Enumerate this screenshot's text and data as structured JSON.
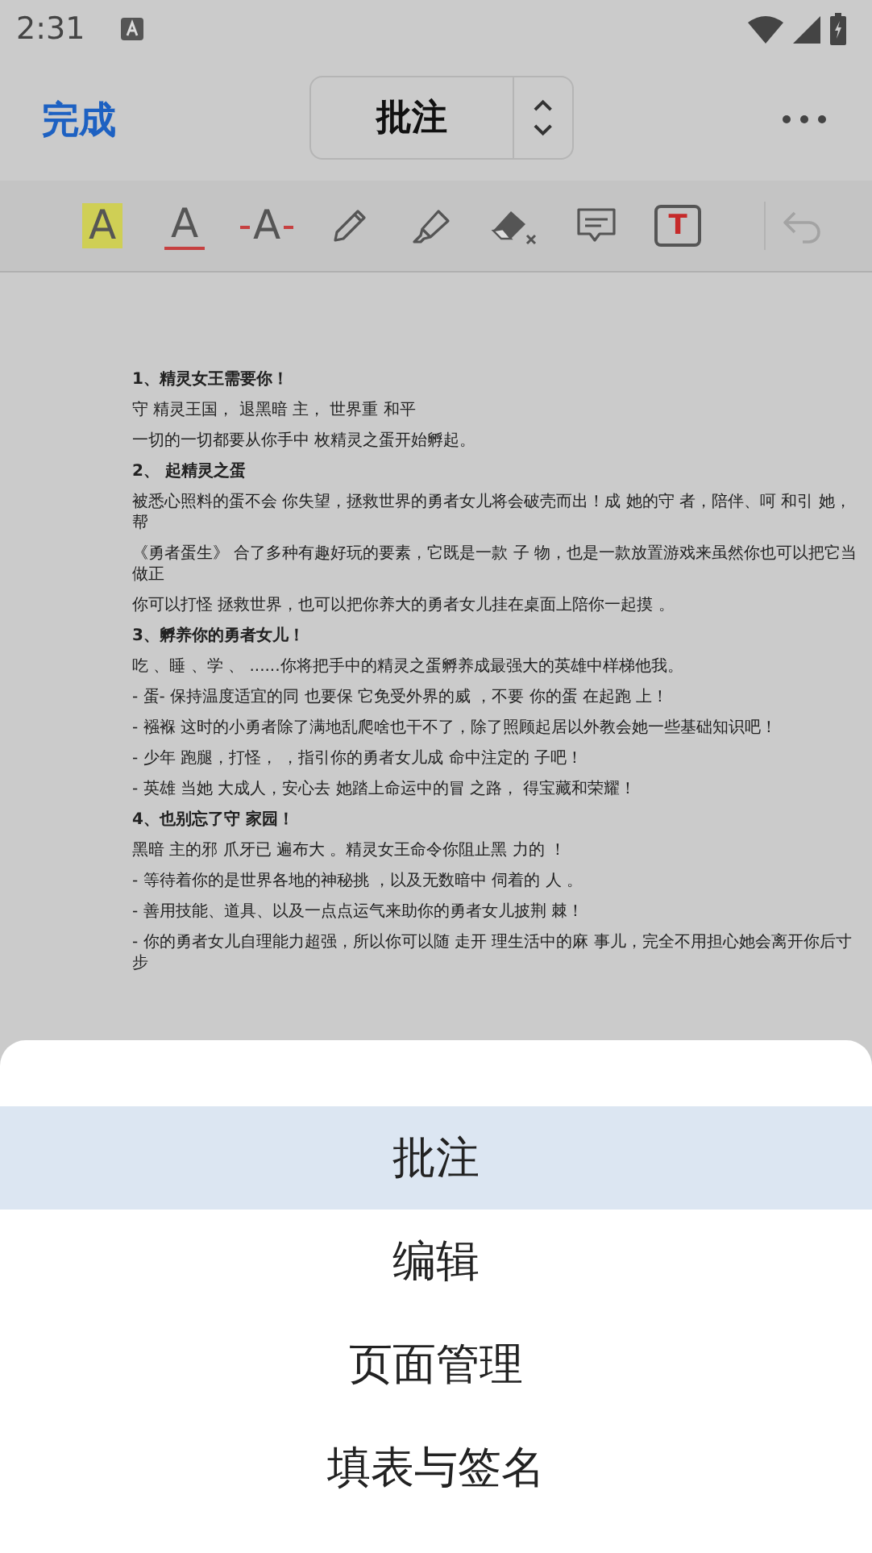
{
  "status_bar": {
    "time": "2:31"
  },
  "header": {
    "done": "完成",
    "mode": "批注"
  },
  "toolbar": {
    "tools": [
      {
        "kind": "highlight",
        "label": "A"
      },
      {
        "kind": "underline",
        "label": "A"
      },
      {
        "kind": "strikeout",
        "label": "A"
      },
      {
        "kind": "pencil"
      },
      {
        "kind": "marker"
      },
      {
        "kind": "eraser"
      },
      {
        "kind": "comment"
      },
      {
        "kind": "textbox",
        "label": "T"
      }
    ],
    "undo": {
      "disabled": true
    }
  },
  "document": {
    "lines": [
      {
        "kind": "heading",
        "text": "1、精灵女王需要你！"
      },
      {
        "kind": "para",
        "text": "守 精灵王国， 退黑暗 主， 世界重 和平"
      },
      {
        "kind": "para",
        "text": "一切的一切都要从你手中 枚精灵之蛋开始孵起。"
      },
      {
        "kind": "heading",
        "text": "2、 起精灵之蛋"
      },
      {
        "kind": "para",
        "text": "被悉心照料的蛋不会 你失望，拯救世界的勇者女儿将会破壳而出！成 她的守 者，陪伴、呵 和引 她，帮"
      },
      {
        "kind": "para",
        "text": "《勇者蛋生》 合了多种有趣好玩的要素，它既是一款 子 物，也是一款放置游戏来虽然你也可以把它当做正"
      },
      {
        "kind": "para",
        "text": "你可以打怪 拯救世界，也可以把你养大的勇者女儿挂在桌面上陪你一起摸 。"
      },
      {
        "kind": "heading",
        "text": "3、孵养你的勇者女儿！"
      },
      {
        "kind": "para",
        "text": "吃 、睡 、学 、 ......你将把手中的精灵之蛋孵养成最强大的英雄中样梯他我。"
      },
      {
        "kind": "para",
        "text": "- 蛋- 保持温度适宜的同 也要保 它免受外界的威 ，不要 你的蛋 在起跑 上！"
      },
      {
        "kind": "para",
        "text": "- 襁褓 这时的小勇者除了满地乱爬啥也干不了，除了照顾起居以外教会她一些基础知识吧！"
      },
      {
        "kind": "para",
        "text": "- 少年 跑腿，打怪， ，指引你的勇者女儿成 命中注定的 子吧！"
      },
      {
        "kind": "para",
        "text": "- 英雄 当她 大成人，安心去 她踏上命运中的冒 之路， 得宝藏和荣耀！"
      },
      {
        "kind": "heading",
        "text": "4、也别忘了守 家园！"
      },
      {
        "kind": "para",
        "text": "黑暗 主的邪 爪牙已 遍布大 。精灵女王命令你阻止黑 力的 ！"
      },
      {
        "kind": "para",
        "text": "- 等待着你的是世界各地的神秘挑 ，以及无数暗中 伺着的 人 。"
      },
      {
        "kind": "para",
        "text": "- 善用技能、道具、以及一点点运气来助你的勇者女儿披荆 棘！"
      },
      {
        "kind": "para",
        "text": "- 你的勇者女儿自理能力超强，所以你可以随 走开 理生活中的麻 事儿，完全不用担心她会离开你后寸步"
      }
    ]
  },
  "sheet": {
    "items": [
      {
        "label": "批注",
        "selected": true
      },
      {
        "label": "编辑",
        "selected": false
      },
      {
        "label": "页面管理",
        "selected": false
      },
      {
        "label": "填表与签名",
        "selected": false
      }
    ]
  }
}
